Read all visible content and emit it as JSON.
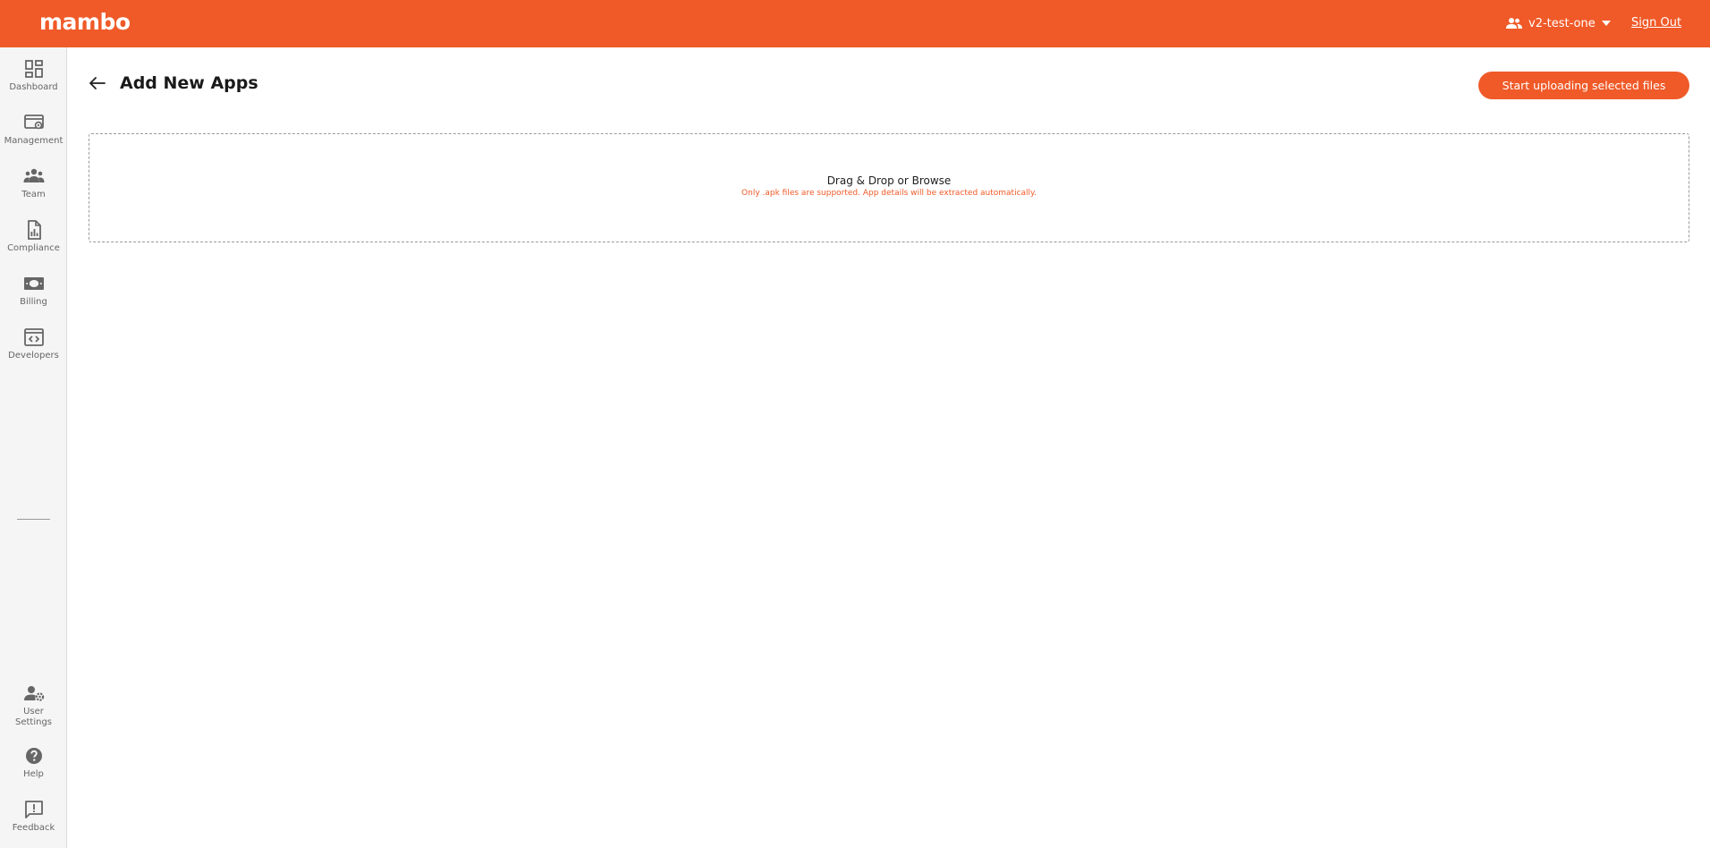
{
  "header": {
    "logo_text": "mambo",
    "account_name": "v2-test-one",
    "sign_out_label": "Sign Out",
    "accent_color": "#f05a28"
  },
  "sidebar": {
    "items": [
      {
        "label": "Dashboard",
        "icon": "dashboard-icon"
      },
      {
        "label": "Management",
        "icon": "management-icon"
      },
      {
        "label": "Team",
        "icon": "team-icon"
      },
      {
        "label": "Compliance",
        "icon": "compliance-icon"
      },
      {
        "label": "Billing",
        "icon": "billing-icon"
      },
      {
        "label": "Developers",
        "icon": "developers-icon"
      }
    ],
    "bottom_items": [
      {
        "label": "User Settings",
        "icon": "user-settings-icon"
      },
      {
        "label": "Help",
        "icon": "help-icon"
      },
      {
        "label": "Feedback",
        "icon": "feedback-icon"
      }
    ]
  },
  "main": {
    "title": "Add New Apps",
    "upload_button_label": "Start uploading selected files",
    "dropzone": {
      "title": "Drag & Drop or Browse",
      "subtitle": "Only .apk files are supported. App details will be extracted automatically."
    }
  }
}
